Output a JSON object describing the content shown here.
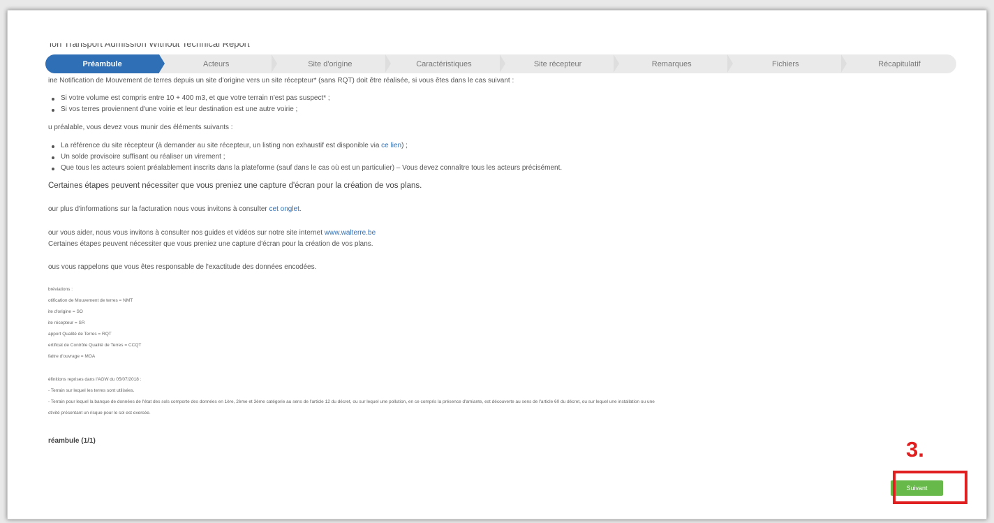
{
  "page": {
    "title": "ion Transport Admission Without Technical Report"
  },
  "stepper": {
    "steps": [
      {
        "label": "Préambule",
        "active": true
      },
      {
        "label": "Acteurs"
      },
      {
        "label": "Site d'origine"
      },
      {
        "label": "Caractéristiques"
      },
      {
        "label": "Site récepteur"
      },
      {
        "label": "Remarques"
      },
      {
        "label": "Fichiers"
      },
      {
        "label": "Récapitulatif"
      }
    ]
  },
  "content": {
    "intro": "ine Notification de Mouvement de terres depuis un site d'origine vers un site récepteur* (sans RQT) doit être réalisée, si vous êtes dans le cas suivant :",
    "cases": [
      "Si votre volume est compris entre 10 + 400 m3, et que votre terrain n'est pas suspect* ;",
      "Si vos terres proviennent d'une voirie et leur destination est une autre voirie ;"
    ],
    "prereq_intro": "u préalable, vous devez vous munir des éléments suivants :",
    "prereqs": [
      {
        "text": "La référence du site récepteur (à demander au site récepteur, un listing non exhaustif est disponible via ",
        "link": "ce lien",
        "after": ") ;"
      },
      {
        "text": "Un solde provisoire suffisant ou réaliser un virement ;"
      },
      {
        "text": "Que tous les acteurs soient préalablement inscrits dans la plateforme (sauf dans le cas où est un particulier) – Vous devez connaître tous les acteurs précisément."
      }
    ],
    "capture_note": "Certaines étapes peuvent nécessiter que vous preniez une capture d'écran pour la création de vos plans.",
    "billing_text": "our plus d'informations sur la facturation nous vous invitons à consulter ",
    "billing_link": "cet onglet",
    "billing_after": ".",
    "help_text": "our vous aider, nous vous invitons à consulter nos guides et vidéos sur notre site internet ",
    "help_link": "www.walterre.be",
    "capture_note_2": "Certaines étapes peuvent nécessiter que vous preniez une capture d'écran pour la création de vos plans.",
    "responsibility": "ous vous rappelons que vous êtes responsable de l'exactitude des données encodées.",
    "abbrev_title": "bréviations :",
    "abbreviations": [
      "otification de Mouvement de terres = NMT",
      "ite d'origine = SO",
      "ite récepteur = SR",
      "apport Qualité de Terres = RQT",
      "ertificat de Contrôle Qualité de Terres = CCQT",
      "fattre d'ouvrage = MOA"
    ],
    "definitions_title": "éfinitions reprises dans l'AGW du 05/07/2018 :",
    "definitions": [
      "- Terrain sur lequel les terres sont utilisées.",
      "- Terrain pour lequel la banque de données de l'état des sols comporte des données en 1ère, 2ème et 3ème catégorie au sens de l'article 12 du décret, ou sur lequel une pollution, en ce compris la présence d'amiante, est découverte au sens de l'article 60 du décret, ou sur lequel une installation ou une",
      "ctivité présentant un risque pour le sol est exercée."
    ],
    "step_counter": "réambule (1/1)"
  },
  "actions": {
    "next_label": "Suivant"
  },
  "annotation": {
    "label": "3.",
    "color": "#e02020"
  },
  "colors": {
    "active_step": "#2f6fb6",
    "next_button": "#67b94a",
    "link": "#2f6fb6"
  }
}
